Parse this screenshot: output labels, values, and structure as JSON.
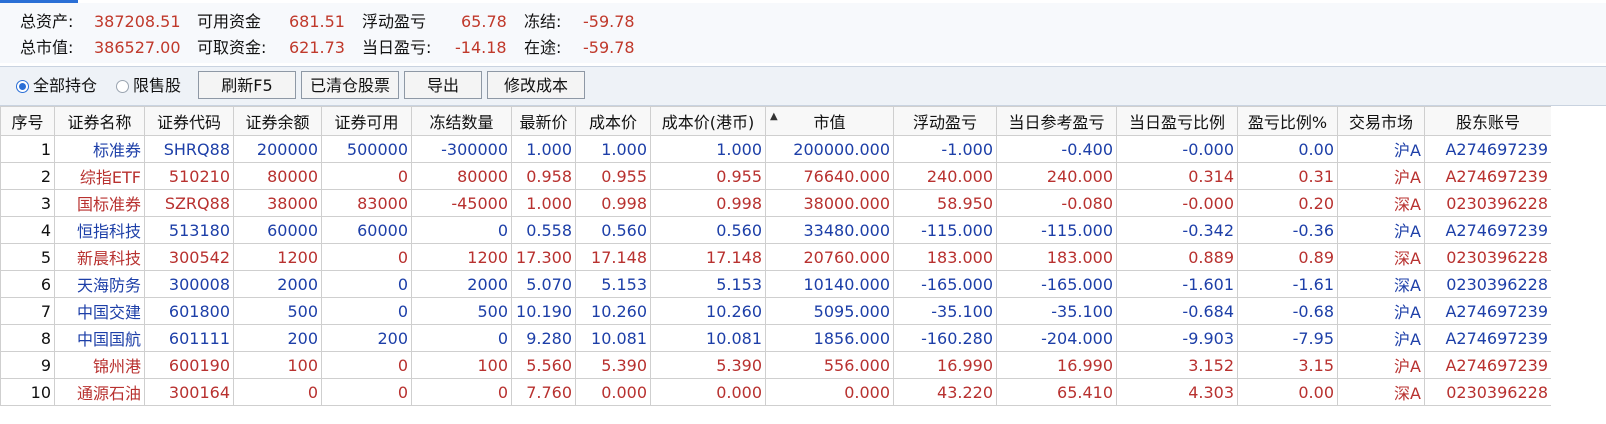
{
  "summary": {
    "row1": [
      {
        "label": "总资产:",
        "value": "387208.51"
      },
      {
        "label": "可用资金",
        "value": "681.51"
      },
      {
        "label": "浮动盈亏",
        "value": "65.78"
      },
      {
        "label": "冻结:",
        "value": "-59.78"
      }
    ],
    "row2": [
      {
        "label": "总市值:",
        "value": "386527.00"
      },
      {
        "label": "可取资金:",
        "value": "621.73"
      },
      {
        "label": "当日盈亏:",
        "value": "-14.18"
      },
      {
        "label": "在途:",
        "value": "-59.78"
      }
    ]
  },
  "toolbar": {
    "radio_all": "全部持仓",
    "radio_restricted": "限售股",
    "btn_refresh": "刷新F5",
    "btn_cleared": "已清仓股票",
    "btn_export": "导出",
    "btn_edit_cost": "修改成本"
  },
  "table": {
    "columns": [
      "序号",
      "证券名称",
      "证券代码",
      "证券余额",
      "证券可用",
      "冻结数量",
      "最新价",
      "成本价",
      "成本价(港币)",
      "市值",
      "浮动盈亏",
      "当日参考盈亏",
      "当日盈亏比例",
      "盈亏比例%",
      "交易市场",
      "股东账号"
    ],
    "sort_column": "市值",
    "rows": [
      {
        "color": "blue",
        "cells": [
          "1",
          "标准券",
          "SHRQ88",
          "200000",
          "500000",
          "-300000",
          "1.000",
          "1.000",
          "1.000",
          "200000.000",
          "-1.000",
          "-0.400",
          "-0.000",
          "0.00",
          "沪A",
          "A274697239"
        ]
      },
      {
        "color": "red",
        "cells": [
          "2",
          "综指ETF",
          "510210",
          "80000",
          "0",
          "80000",
          "0.958",
          "0.955",
          "0.955",
          "76640.000",
          "240.000",
          "240.000",
          "0.314",
          "0.31",
          "沪A",
          "A274697239"
        ]
      },
      {
        "color": "red",
        "cells": [
          "3",
          "国标准券",
          "SZRQ88",
          "38000",
          "83000",
          "-45000",
          "1.000",
          "0.998",
          "0.998",
          "38000.000",
          "58.950",
          "-0.080",
          "-0.000",
          "0.20",
          "深A",
          "0230396228"
        ]
      },
      {
        "color": "blue",
        "cells": [
          "4",
          "恒指科技",
          "513180",
          "60000",
          "60000",
          "0",
          "0.558",
          "0.560",
          "0.560",
          "33480.000",
          "-115.000",
          "-115.000",
          "-0.342",
          "-0.36",
          "沪A",
          "A274697239"
        ]
      },
      {
        "color": "red",
        "cells": [
          "5",
          "新晨科技",
          "300542",
          "1200",
          "0",
          "1200",
          "17.300",
          "17.148",
          "17.148",
          "20760.000",
          "183.000",
          "183.000",
          "0.889",
          "0.89",
          "深A",
          "0230396228"
        ]
      },
      {
        "color": "blue",
        "cells": [
          "6",
          "天海防务",
          "300008",
          "2000",
          "0",
          "2000",
          "5.070",
          "5.153",
          "5.153",
          "10140.000",
          "-165.000",
          "-165.000",
          "-1.601",
          "-1.61",
          "深A",
          "0230396228"
        ]
      },
      {
        "color": "blue",
        "cells": [
          "7",
          "中国交建",
          "601800",
          "500",
          "0",
          "500",
          "10.190",
          "10.260",
          "10.260",
          "5095.000",
          "-35.100",
          "-35.100",
          "-0.684",
          "-0.68",
          "沪A",
          "A274697239"
        ]
      },
      {
        "color": "blue",
        "cells": [
          "8",
          "中国国航",
          "601111",
          "200",
          "200",
          "0",
          "9.280",
          "10.081",
          "10.081",
          "1856.000",
          "-160.280",
          "-204.000",
          "-9.903",
          "-7.95",
          "沪A",
          "A274697239"
        ]
      },
      {
        "color": "red",
        "cells": [
          "9",
          "锦州港",
          "600190",
          "100",
          "0",
          "100",
          "5.560",
          "5.390",
          "5.390",
          "556.000",
          "16.990",
          "16.990",
          "3.152",
          "3.15",
          "沪A",
          "A274697239"
        ]
      },
      {
        "color": "red",
        "cells": [
          "10",
          "通源石油",
          "300164",
          "0",
          "0",
          "0",
          "7.760",
          "0.000",
          "0.000",
          "0.000",
          "43.220",
          "65.410",
          "4.303",
          "0.00",
          "深A",
          "0230396228"
        ]
      }
    ]
  },
  "colors": {
    "accent": "#2a6fd6",
    "profit_red": "#b8312f",
    "loss_blue": "#1d3fa8"
  }
}
